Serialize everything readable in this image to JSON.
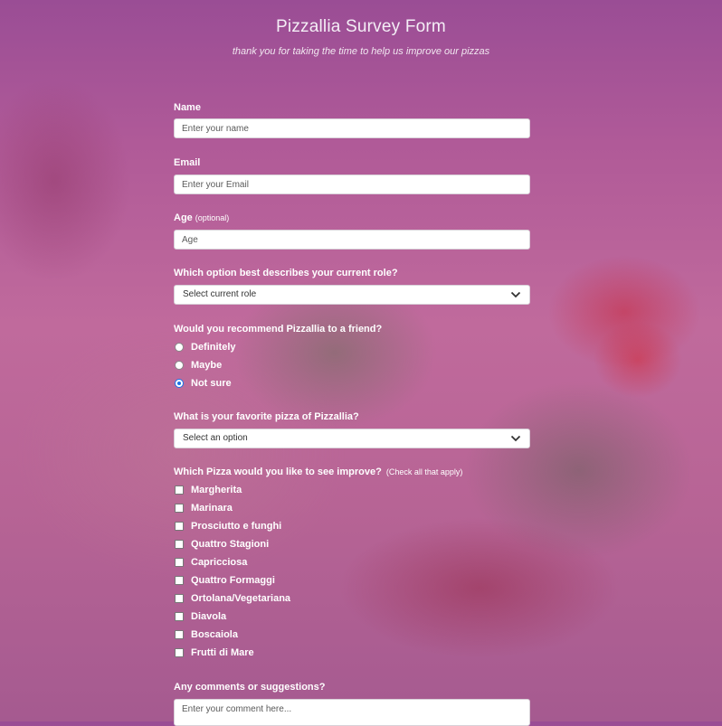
{
  "header": {
    "title": "Pizzallia Survey Form",
    "subtitle": "thank you for taking the time to help us improve our pizzas"
  },
  "form": {
    "name": {
      "label": "Name",
      "placeholder": "Enter your name"
    },
    "email": {
      "label": "Email",
      "placeholder": "Enter your Email"
    },
    "age": {
      "label": "Age",
      "hint": "(optional)",
      "placeholder": "Age"
    },
    "role": {
      "label": "Which option best describes your current role?",
      "selected": "Select current role"
    },
    "recommend": {
      "label": "Would you recommend Pizzallia to a friend?",
      "options": [
        "Definitely",
        "Maybe",
        "Not sure"
      ],
      "selected": "Not sure"
    },
    "favorite": {
      "label": "What is your favorite pizza of Pizzallia?",
      "selected": "Select an option"
    },
    "improve": {
      "label": "Which Pizza would you like to see improve?",
      "hint": "(Check all that apply)",
      "options": [
        "Margherita",
        "Marinara",
        "Prosciutto e funghi",
        "Quattro Stagioni",
        "Capricciosa",
        "Quattro Formaggi",
        "Ortolana/Vegetariana",
        "Diavola",
        "Boscaiola",
        "Frutti di Mare"
      ]
    },
    "comments": {
      "label": "Any comments or suggestions?",
      "placeholder": "Enter your comment here..."
    }
  },
  "icons": {
    "select_chevron": "chevron-down-icon"
  },
  "colors": {
    "radio_accent": "#1a73e8",
    "overlay": "#b05a98"
  }
}
